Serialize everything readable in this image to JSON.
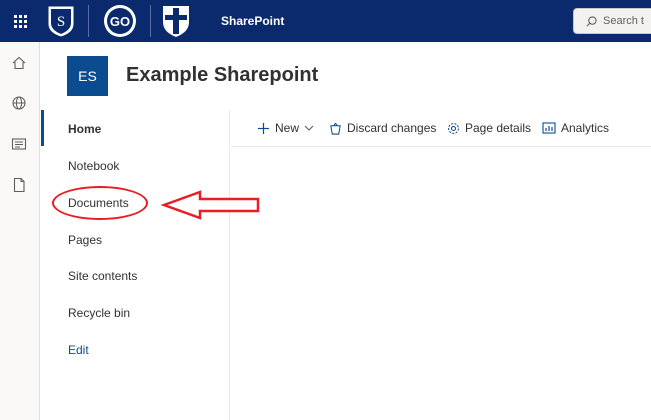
{
  "suitebar": {
    "brand": "SharePoint",
    "search_placeholder": "Search t",
    "logo_go_text": "GO"
  },
  "site": {
    "logo_initials": "ES",
    "title": "Example Sharepoint"
  },
  "leftnav": {
    "items": [
      {
        "label": "Home",
        "selected": true
      },
      {
        "label": "Notebook"
      },
      {
        "label": "Documents"
      },
      {
        "label": "Pages"
      },
      {
        "label": "Site contents"
      },
      {
        "label": "Recycle bin"
      },
      {
        "label": "Edit"
      }
    ]
  },
  "commandbar": {
    "new_label": "New",
    "discard_label": "Discard changes",
    "page_details_label": "Page details",
    "analytics_label": "Analytics"
  },
  "colors": {
    "suitebar_bg": "#0b2a6e",
    "accent": "#0b4b8f",
    "annotation": "#e81d25"
  }
}
